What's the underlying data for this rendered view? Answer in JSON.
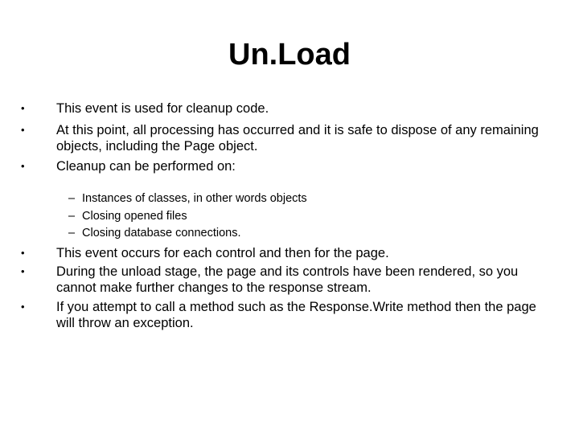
{
  "slide": {
    "title": "Un.Load",
    "bullets_top": [
      {
        "marker": "•",
        "text": "This event is used for cleanup code."
      },
      {
        "marker": "•",
        "text": "At this point, all processing has occurred and it is safe to dispose of any remaining objects, including the Page object."
      },
      {
        "marker": "•",
        "text": "Cleanup can be performed on:"
      }
    ],
    "sub_bullets": [
      {
        "marker": "–",
        "text": "Instances of classes, in other words objects"
      },
      {
        "marker": "–",
        "text": "Closing opened files"
      },
      {
        "marker": "–",
        "text": "Closing database connections."
      }
    ],
    "bullets_bottom": [
      {
        "marker": "•",
        "text": "This event occurs for each control and then for the page."
      },
      {
        "marker": "•",
        "text": "During the unload stage, the page and its controls have been rendered, so you cannot make further changes to the response stream."
      },
      {
        "marker": "•",
        "text": "If you attempt to call a method such as the Response.Write method then the page will throw an exception."
      }
    ]
  }
}
